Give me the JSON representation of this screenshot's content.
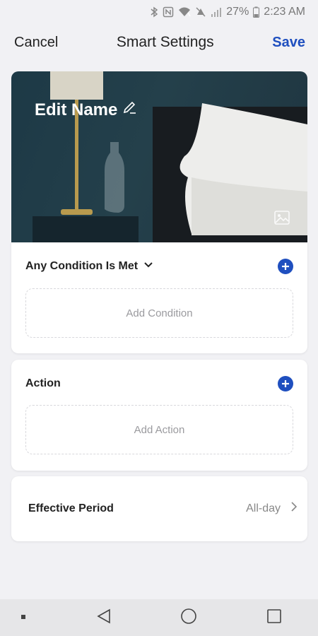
{
  "status_bar": {
    "battery": "27%",
    "time": "2:23 AM",
    "icons": [
      "bluetooth-icon",
      "nfc-icon",
      "wifi-icon",
      "mute-icon",
      "signal-icon",
      "battery-icon"
    ]
  },
  "header": {
    "cancel_label": "Cancel",
    "title": "Smart Settings",
    "save_label": "Save"
  },
  "hero": {
    "name": "Edit Name",
    "edit_icon": "pencil-icon",
    "image_icon": "image-icon"
  },
  "condition_card": {
    "title": "Any Condition Is Met",
    "add_placeholder": "Add Condition"
  },
  "action_card": {
    "title": "Action",
    "add_placeholder": "Add Action"
  },
  "effective_period": {
    "label": "Effective Period",
    "value": "All-day"
  },
  "colors": {
    "accent": "#1f4fbf",
    "background": "#f1f1f4"
  },
  "nav_bar": {
    "icons": [
      "recents-dot-icon",
      "back-icon",
      "home-icon",
      "overview-icon"
    ]
  }
}
